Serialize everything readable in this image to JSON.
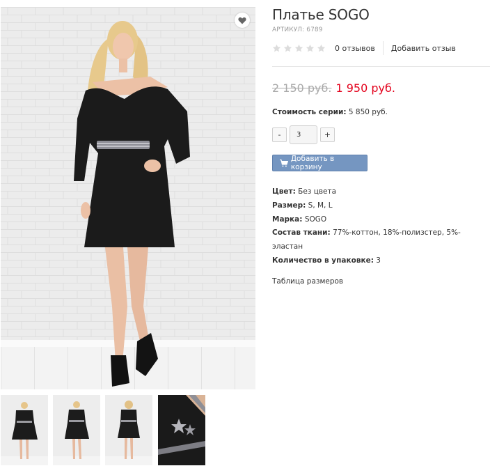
{
  "product": {
    "title": "Платье SOGO",
    "sku": "АРТИКУЛ: 6789",
    "rating": 0,
    "rating_max": 5,
    "reviews": "0 отзывов",
    "add_review": "Добавить отзыв",
    "old_price": "2 150 руб.",
    "new_price": "1 950 руб.",
    "series_label": "Стоимость серии:",
    "series_value": "5 850 руб.",
    "qty_minus": "-",
    "qty_value": "3",
    "qty_plus": "+",
    "cart_button": "Добавить в корзину"
  },
  "props": [
    {
      "label": "Цвет:",
      "value": "Без цвета"
    },
    {
      "label": "Размер:",
      "value": "S, M, L"
    },
    {
      "label": "Марка:",
      "value": "SOGO"
    },
    {
      "label": "Состав ткани:",
      "value": "77%-коттон, 18%-полизстер, 5%-эластан"
    },
    {
      "label": "Количество в упаковке:",
      "value": "3"
    }
  ],
  "size_table_link": "Таблица размеров",
  "icons": {
    "favorite": "heart-icon",
    "cart": "shopping-cart-icon",
    "rating": "star-icon"
  },
  "colors": {
    "price_new": "#e3001b",
    "price_old": "#a9a9a9",
    "cart_button": "#7596c1",
    "star_empty": "#dcdcdc"
  }
}
